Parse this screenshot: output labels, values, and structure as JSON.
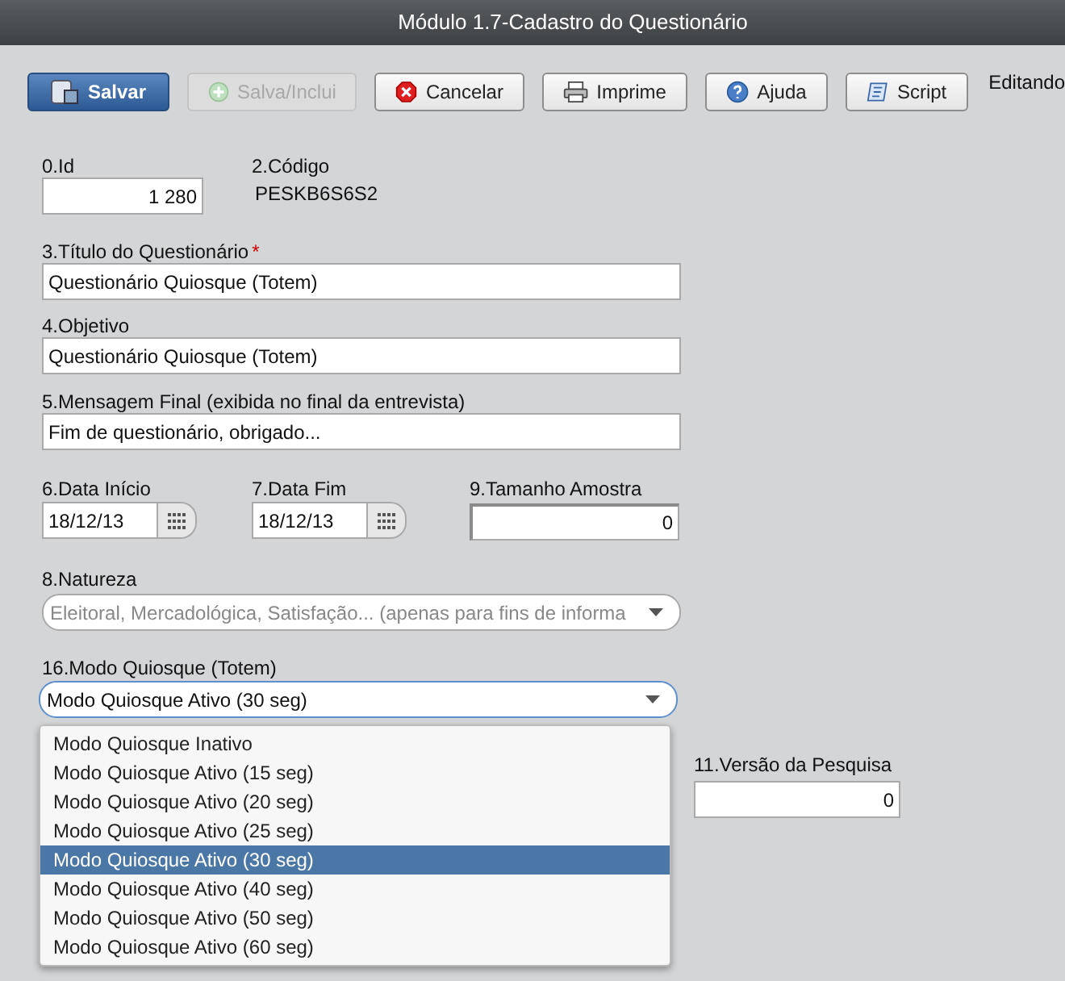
{
  "window": {
    "title": "Módulo 1.7-Cadastro do Questionário"
  },
  "toolbar": {
    "buttons": [
      {
        "label": "Salvar",
        "kind": "save",
        "disabled": false,
        "primary": true
      },
      {
        "label": "Salva/Inclui",
        "kind": "add",
        "disabled": true,
        "primary": false
      },
      {
        "label": "Cancelar",
        "kind": "cancel",
        "disabled": false,
        "primary": false
      },
      {
        "label": "Imprime",
        "kind": "print",
        "disabled": false,
        "primary": false
      },
      {
        "label": "Ajuda",
        "kind": "help",
        "disabled": false,
        "primary": false
      },
      {
        "label": "Script",
        "kind": "script",
        "disabled": false,
        "primary": false
      }
    ],
    "mode": "Editando"
  },
  "form": {
    "id": {
      "label": "0.Id",
      "value": "1 280"
    },
    "code": {
      "label": "2.Código",
      "value": "PESKB6S6S2"
    },
    "title": {
      "label": "3.Título do Questionário",
      "required_mark": "*",
      "value": "Questionário Quiosque (Totem)"
    },
    "objective": {
      "label": "4.Objetivo",
      "value": "Questionário Quiosque (Totem)"
    },
    "final_message": {
      "label": "5.Mensagem Final (exibida no final da entrevista)",
      "value": "Fim de questionário, obrigado..."
    },
    "start_date": {
      "label": "6.Data Início",
      "value": "18/12/13"
    },
    "end_date": {
      "label": "7.Data Fim",
      "value": "18/12/13"
    },
    "sample_size": {
      "label": "9.Tamanho Amostra",
      "value": "0"
    },
    "nature": {
      "label": "8.Natureza",
      "placeholder": "Eleitoral, Mercadológica, Satisfação... (apenas para fins de informa"
    },
    "kiosk": {
      "label": "16.Modo Quiosque (Totem)",
      "value": "Modo Quiosque Ativo (30 seg)",
      "expanded": true,
      "options": [
        {
          "label": "Modo Quiosque Inativo",
          "selected": false
        },
        {
          "label": "Modo Quiosque Ativo (15 seg)",
          "selected": false
        },
        {
          "label": "Modo Quiosque Ativo (20 seg)",
          "selected": false
        },
        {
          "label": "Modo Quiosque Ativo (25 seg)",
          "selected": false
        },
        {
          "label": "Modo Quiosque Ativo (30 seg)",
          "selected": true
        },
        {
          "label": "Modo Quiosque Ativo (40 seg)",
          "selected": false
        },
        {
          "label": "Modo Quiosque Ativo (50 seg)",
          "selected": false
        },
        {
          "label": "Modo Quiosque Ativo (60 seg)",
          "selected": false
        }
      ]
    },
    "version": {
      "label": "11.Versão da Pesquisa",
      "value": "0"
    }
  }
}
